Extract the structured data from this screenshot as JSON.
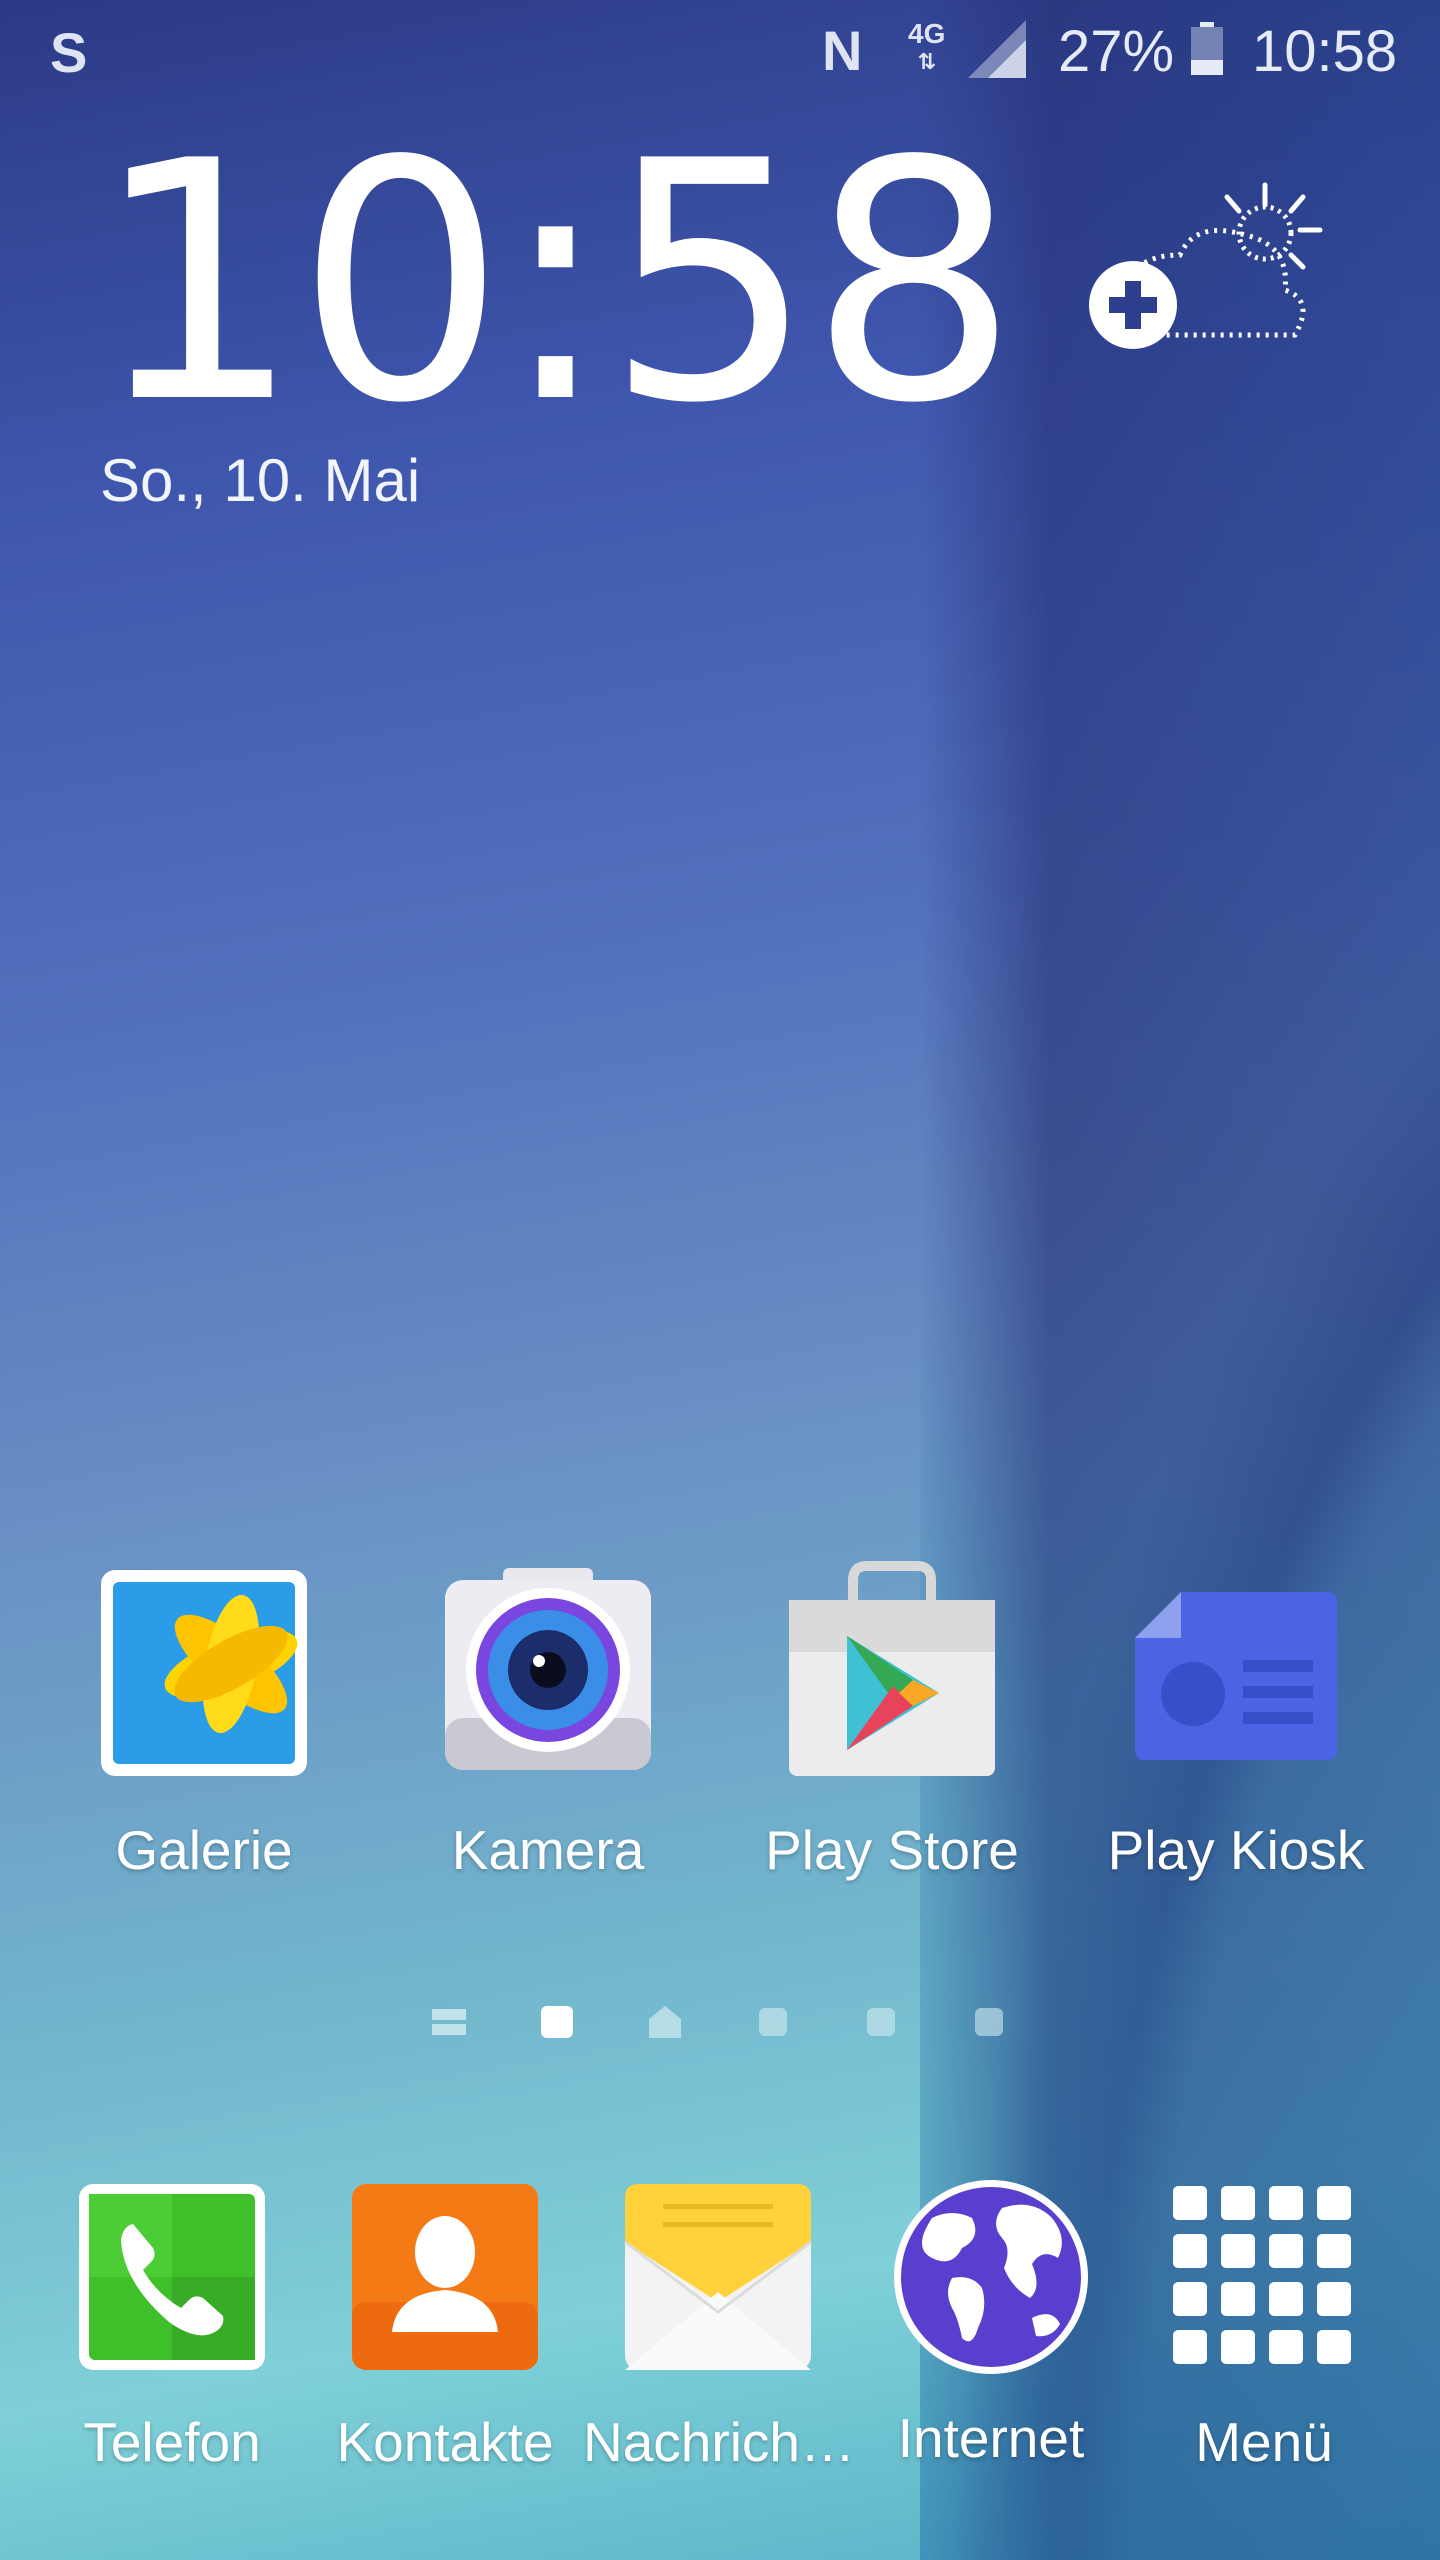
{
  "status_bar": {
    "network_type": "4G",
    "battery_percent": "27%",
    "time": "10:58"
  },
  "clock_widget": {
    "time": "10:58",
    "date": "So., 10. Mai"
  },
  "apps": [
    {
      "label": "Galerie",
      "icon": "gallery-icon"
    },
    {
      "label": "Kamera",
      "icon": "camera-icon"
    },
    {
      "label": "Play Store",
      "icon": "play-store-icon"
    },
    {
      "label": "Play Kiosk",
      "icon": "play-newsstand-icon"
    }
  ],
  "page_indicator": {
    "pages": 6,
    "current_page": 2
  },
  "dock": [
    {
      "label": "Telefon",
      "icon": "phone-icon"
    },
    {
      "label": "Kontakte",
      "icon": "contacts-icon"
    },
    {
      "label": "Nachrich…",
      "icon": "messages-icon"
    },
    {
      "label": "Internet",
      "icon": "internet-icon"
    },
    {
      "label": "Menü",
      "icon": "app-menu-icon"
    }
  ],
  "colors": {
    "phone_green": "#3fbf2a",
    "contacts_orange": "#f47a16",
    "messages_yellow": "#ffd23c",
    "internet_purple": "#5a3fcf",
    "kiosk_blue": "#4a64e4"
  }
}
